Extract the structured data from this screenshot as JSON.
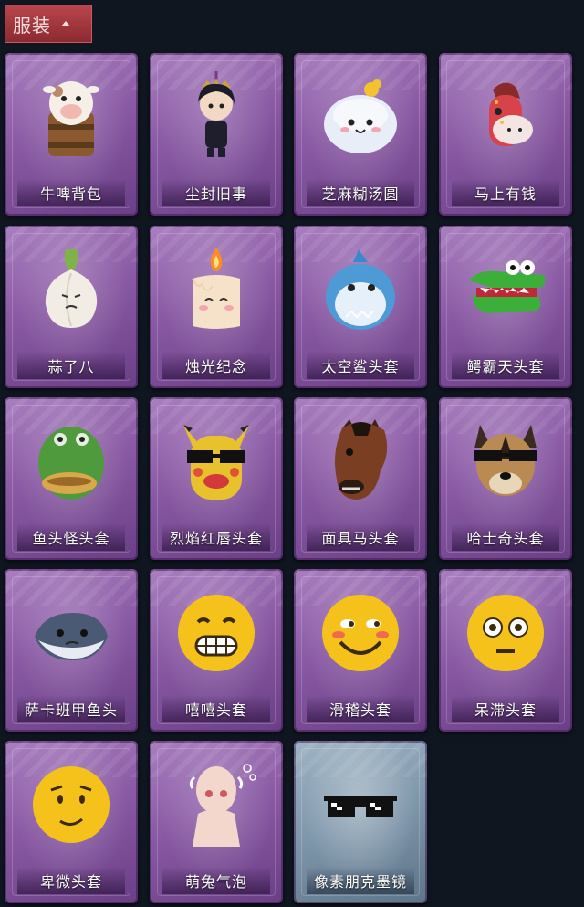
{
  "header": {
    "title": "服装",
    "icon": "chevron-up-icon"
  },
  "colors": {
    "card_purple": "#8a5aa4",
    "card_special": "#7e96aa",
    "header_red": "#a3363c",
    "background": "#0f1620"
  },
  "items": [
    {
      "name": "牛啤背包",
      "icon": "cow-beer-backpack-icon",
      "style": "purple"
    },
    {
      "name": "尘封旧事",
      "icon": "chibi-character-icon",
      "style": "purple"
    },
    {
      "name": "芝麻糊汤圆",
      "icon": "tangyuan-icon",
      "style": "purple"
    },
    {
      "name": "马上有钱",
      "icon": "red-horse-head-icon",
      "style": "purple"
    },
    {
      "name": "蒜了八",
      "icon": "garlic-icon",
      "style": "purple"
    },
    {
      "name": "烛光纪念",
      "icon": "candle-icon",
      "style": "purple"
    },
    {
      "name": "太空鲨头套",
      "icon": "shark-head-icon",
      "style": "purple"
    },
    {
      "name": "鳄霸天头套",
      "icon": "crocodile-head-icon",
      "style": "purple"
    },
    {
      "name": "鱼头怪头套",
      "icon": "fish-head-icon",
      "style": "purple"
    },
    {
      "name": "烈焰红唇头套",
      "icon": "yellow-mask-sunglasses-icon",
      "style": "purple"
    },
    {
      "name": "面具马头套",
      "icon": "horse-mask-icon",
      "style": "purple"
    },
    {
      "name": "哈士奇头套",
      "icon": "husky-head-icon",
      "style": "purple"
    },
    {
      "name": "萨卡班甲鱼头",
      "icon": "sacabambaspis-icon",
      "style": "purple"
    },
    {
      "name": "嘻嘻头套",
      "icon": "grinning-emoji-icon",
      "style": "purple"
    },
    {
      "name": "滑稽头套",
      "icon": "smirk-emoji-icon",
      "style": "purple"
    },
    {
      "name": "呆滞头套",
      "icon": "stunned-emoji-icon",
      "style": "purple"
    },
    {
      "name": "卑微头套",
      "icon": "timid-emoji-icon",
      "style": "purple"
    },
    {
      "name": "萌兔气泡",
      "icon": "bubble-avatar-icon",
      "style": "purple"
    },
    {
      "name": "像素朋克墨镜",
      "icon": "pixel-sunglasses-icon",
      "style": "special"
    }
  ]
}
